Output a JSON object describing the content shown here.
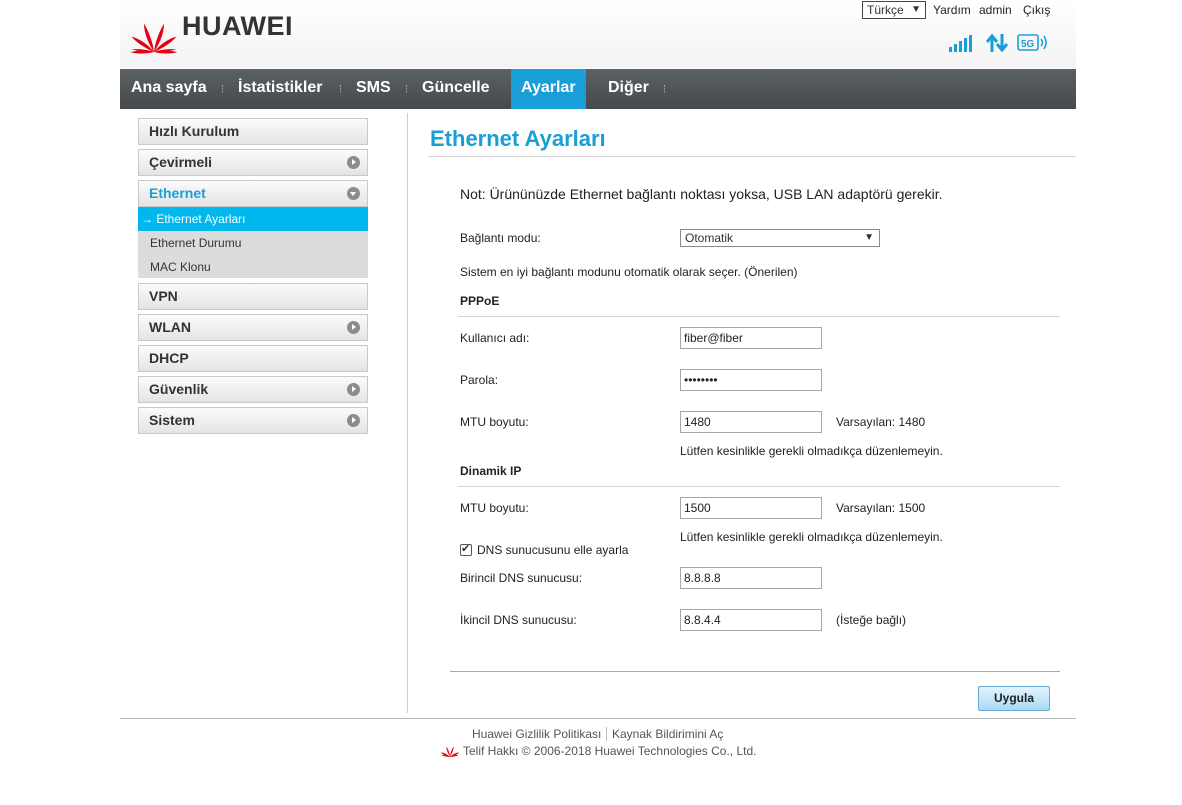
{
  "header": {
    "brand": "HUAWEI",
    "language": "Türkçe",
    "help": "Yardım",
    "user": "admin",
    "logout": "Çıkış",
    "status": [
      "signal-strength-icon",
      "data-transfer-icon",
      "5g-icon"
    ]
  },
  "nav": {
    "items": [
      "Ana sayfa",
      "İstatistikler",
      "SMS",
      "Güncelle",
      "Ayarlar",
      "Diğer"
    ],
    "active": "Ayarlar",
    "accent": "#1a9ed8"
  },
  "sidebar": {
    "items": [
      "Hızlı Kurulum",
      "Çevirmeli",
      "Ethernet",
      "VPN",
      "WLAN",
      "DHCP",
      "Güvenlik",
      "Sistem"
    ],
    "expanded": "Ethernet",
    "sub_items": [
      "Ethernet Ayarları",
      "Ethernet Durumu",
      "MAC Klonu"
    ],
    "active_sub": "Ethernet Ayarları",
    "active_sub_prefix": "→"
  },
  "main": {
    "title": "Ethernet Ayarları",
    "note": "Not: Ürününüzde Ethernet bağlantı noktası yoksa, USB LAN adaptörü gerekir.",
    "connection_mode_label": "Bağlantı modu:",
    "connection_mode_value": "Otomatik",
    "connection_mode_hint": "Sistem en iyi bağlantı modunu otomatik olarak seçer. (Önerilen)",
    "pppoe": {
      "heading": "PPPoE",
      "username_label": "Kullanıcı adı:",
      "username_value": "fiber@fiber",
      "password_label": "Parola:",
      "password_value": "••••••••",
      "mtu_label": "MTU boyutu:",
      "mtu_value": "1480",
      "mtu_default": "Varsayılan: 1480",
      "mtu_warning": "Lütfen kesinlikle gerekli olmadıkça düzenlemeyin."
    },
    "dynamic_ip": {
      "heading": "Dinamik IP",
      "mtu_label": "MTU boyutu:",
      "mtu_value": "1500",
      "mtu_default": "Varsayılan: 1500",
      "mtu_warning": "Lütfen kesinlikle gerekli olmadıkça düzenlemeyin.",
      "dns_manual_label": "DNS sunucusunu elle ayarla",
      "dns_manual_checked": true,
      "primary_dns_label": "Birincil DNS sunucusu:",
      "primary_dns_value": "8.8.8.8",
      "secondary_dns_label": "İkincil DNS sunucusu:",
      "secondary_dns_value": "8.8.4.4",
      "secondary_dns_hint": "(İsteğe bağlı)"
    },
    "apply_label": "Uygula"
  },
  "footer": {
    "privacy": "Huawei Gizlilik Politikası",
    "open_source": "Kaynak Bildirimini Aç",
    "copyright": "Telif Hakkı © 2006-2018 Huawei Technologies Co., Ltd."
  }
}
